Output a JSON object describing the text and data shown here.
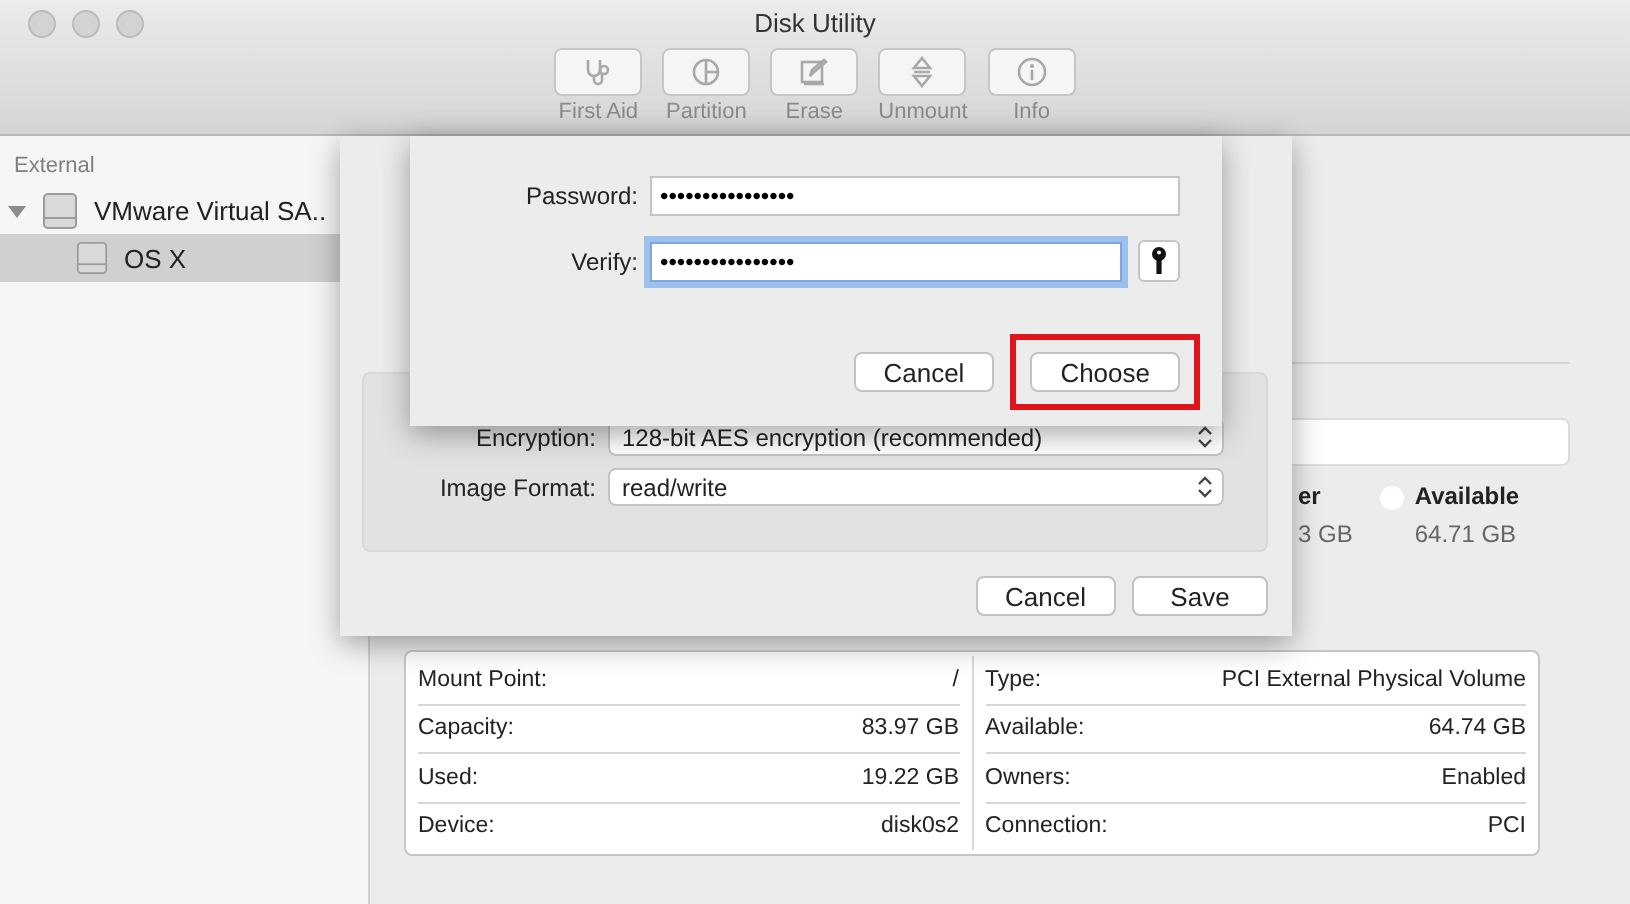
{
  "window": {
    "title": "Disk Utility"
  },
  "toolbar": [
    {
      "kind": "first_aid",
      "label": "First Aid",
      "disabled": true
    },
    {
      "kind": "partition",
      "label": "Partition",
      "disabled": true
    },
    {
      "kind": "erase",
      "label": "Erase",
      "disabled": true
    },
    {
      "kind": "unmount",
      "label": "Unmount",
      "disabled": true
    },
    {
      "kind": "info",
      "label": "Info",
      "disabled": true
    }
  ],
  "sidebar": {
    "section": "External",
    "items": [
      {
        "label": "VMware Virtual SA..",
        "selected": false,
        "expanded": true,
        "children": [
          {
            "label": "OS X",
            "selected": true
          }
        ]
      }
    ]
  },
  "legend": [
    {
      "label": "er",
      "value": "3 GB"
    },
    {
      "label": "Available",
      "value": "64.71 GB",
      "color": "#ffffff"
    }
  ],
  "info_table": {
    "left": [
      {
        "label": "Mount Point:",
        "value": "/"
      },
      {
        "label": "Capacity:",
        "value": "83.97 GB"
      },
      {
        "label": "Used:",
        "value": "19.22 GB"
      },
      {
        "label": "Device:",
        "value": "disk0s2"
      }
    ],
    "right": [
      {
        "label": "Type:",
        "value": "PCI External Physical Volume"
      },
      {
        "label": "Available:",
        "value": "64.74 GB"
      },
      {
        "label": "Owners:",
        "value": "Enabled"
      },
      {
        "label": "Connection:",
        "value": "PCI"
      }
    ]
  },
  "save_sheet": {
    "fields": [
      {
        "label": "Encryption:",
        "value": "128-bit AES encryption (recommended)"
      },
      {
        "label": "Image Format:",
        "value": "read/write"
      }
    ],
    "buttons": [
      {
        "label": "Cancel"
      },
      {
        "label": "Save"
      }
    ]
  },
  "password_sheet": {
    "fields": [
      {
        "label": "Password:",
        "value": "••••••••••••••••",
        "focused": false
      },
      {
        "label": "Verify:",
        "value": "••••••••••••••••",
        "focused": true
      }
    ],
    "buttons": [
      {
        "label": "Cancel",
        "highlighted": false
      },
      {
        "label": "Choose",
        "highlighted": true
      }
    ]
  }
}
